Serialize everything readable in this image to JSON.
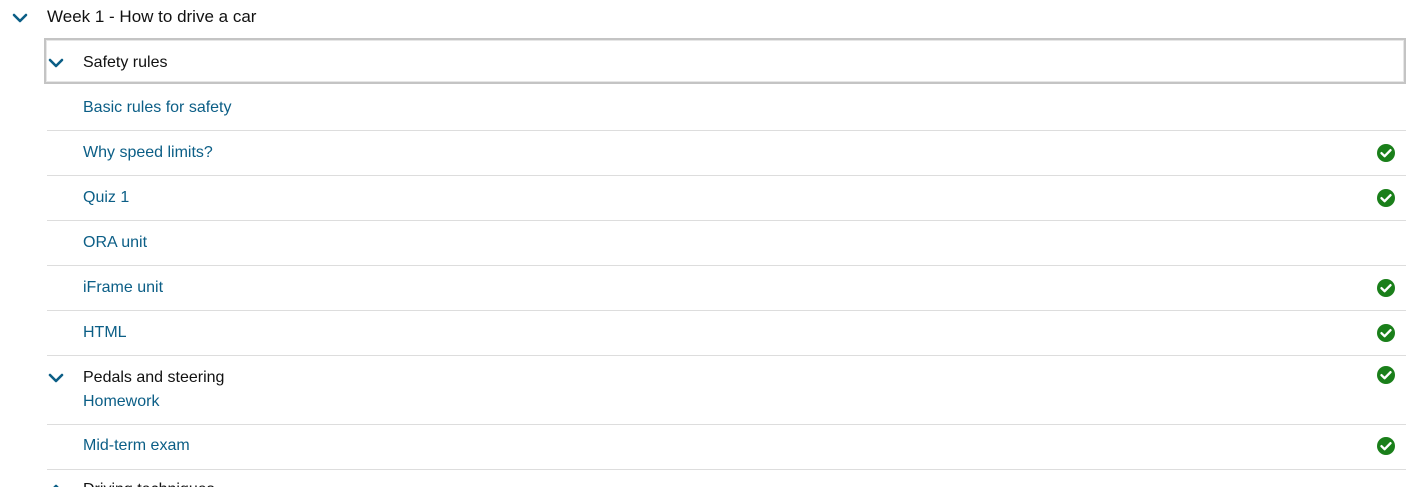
{
  "week": {
    "title": "Week 1 - How to drive a car"
  },
  "section": {
    "title": "Safety rules",
    "units": [
      {
        "label": "Basic rules for safety",
        "completed": false
      },
      {
        "label": "Why speed limits?",
        "completed": true
      },
      {
        "label": "Quiz 1",
        "completed": true
      },
      {
        "label": "ORA unit",
        "completed": false
      },
      {
        "label": "iFrame unit",
        "completed": true
      },
      {
        "label": "HTML",
        "completed": true
      }
    ]
  },
  "subsection": {
    "title": "Pedals and steering",
    "completed": true,
    "units": [
      {
        "label": "Homework",
        "completed": false
      },
      {
        "label": "Mid-term exam",
        "completed": true
      }
    ]
  },
  "next_section": {
    "title": "Driving techniques"
  },
  "colors": {
    "link": "#0b5e86",
    "check": "#1a7f1a",
    "chevron": "#0b5e86",
    "divider": "#dddddd"
  },
  "icons": {
    "expand": "chevron-down-icon",
    "complete": "check-circle-icon"
  }
}
